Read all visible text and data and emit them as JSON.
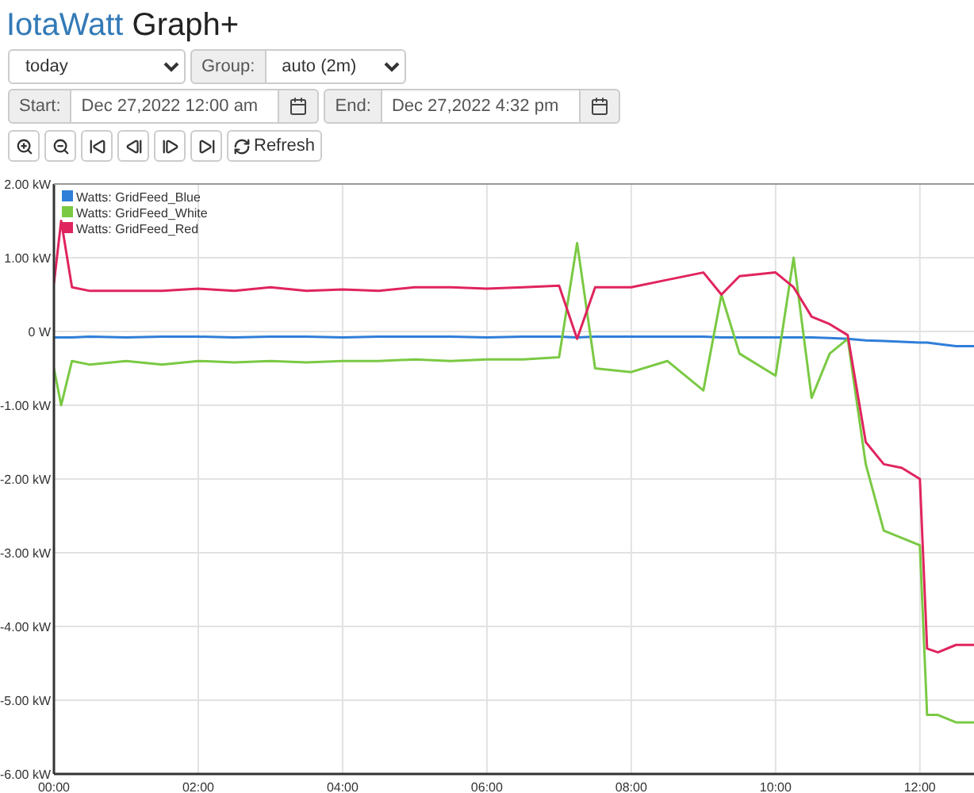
{
  "title": {
    "brand": "IotaWatt",
    "suffix": "Graph+"
  },
  "period_select": {
    "value": "today"
  },
  "group": {
    "label": "Group:",
    "value": "auto (2m)"
  },
  "start": {
    "label": "Start:",
    "value": "Dec 27,2022 12:00 am"
  },
  "end": {
    "label": "End:",
    "value": "Dec 27,2022 4:32 pm"
  },
  "toolbar": [
    {
      "kind": "zoom-in"
    },
    {
      "kind": "zoom-out"
    },
    {
      "kind": "first"
    },
    {
      "kind": "prev"
    },
    {
      "kind": "next"
    },
    {
      "kind": "last"
    },
    {
      "kind": "refresh",
      "label": "Refresh"
    }
  ],
  "chart": {
    "chart_data": {
      "type": "line",
      "grid": true,
      "legend": true,
      "x": [
        0,
        0.1,
        0.25,
        0.5,
        1,
        1.5,
        2,
        2.5,
        3,
        3.5,
        4,
        4.5,
        5,
        5.5,
        6,
        6.5,
        7,
        7.25,
        7.5,
        8,
        8.5,
        9,
        9.25,
        9.5,
        10,
        10.25,
        10.5,
        10.75,
        11,
        11.25,
        11.5,
        11.75,
        12,
        12.1,
        12.25,
        12.5,
        12.75
      ],
      "series": [
        {
          "name": "Watts: GridFeed_Blue",
          "color": "#2f7ed8",
          "values": [
            -0.08,
            -0.08,
            -0.08,
            -0.07,
            -0.08,
            -0.07,
            -0.07,
            -0.08,
            -0.07,
            -0.07,
            -0.08,
            -0.07,
            -0.07,
            -0.07,
            -0.08,
            -0.07,
            -0.07,
            -0.08,
            -0.07,
            -0.07,
            -0.07,
            -0.07,
            -0.08,
            -0.08,
            -0.08,
            -0.08,
            -0.08,
            -0.09,
            -0.1,
            -0.12,
            -0.13,
            -0.14,
            -0.15,
            -0.15,
            -0.17,
            -0.2,
            -0.2
          ]
        },
        {
          "name": "Watts: GridFeed_White",
          "color": "#7ac943",
          "values": [
            -0.5,
            -1.0,
            -0.4,
            -0.45,
            -0.4,
            -0.45,
            -0.4,
            -0.42,
            -0.4,
            -0.42,
            -0.4,
            -0.4,
            -0.38,
            -0.4,
            -0.38,
            -0.38,
            -0.35,
            1.2,
            -0.5,
            -0.55,
            -0.4,
            -0.8,
            0.5,
            -0.3,
            -0.6,
            1.0,
            -0.9,
            -0.3,
            -0.1,
            -1.8,
            -2.7,
            -2.8,
            -2.9,
            -5.2,
            -5.2,
            -5.3,
            -5.3
          ]
        },
        {
          "name": "Watts: GridFeed_Red",
          "color": "#e0245e",
          "values": [
            0.65,
            1.5,
            0.6,
            0.55,
            0.55,
            0.55,
            0.58,
            0.55,
            0.6,
            0.55,
            0.57,
            0.55,
            0.6,
            0.6,
            0.58,
            0.6,
            0.62,
            -0.1,
            0.6,
            0.6,
            0.7,
            0.8,
            0.5,
            0.75,
            0.8,
            0.6,
            0.2,
            0.1,
            -0.05,
            -1.5,
            -1.8,
            -1.85,
            -2.0,
            -4.3,
            -4.35,
            -4.25,
            -4.25
          ]
        }
      ],
      "xlim": [
        0,
        12.75
      ],
      "ylim": [
        -6,
        2
      ],
      "xticks": [
        {
          "value": 0,
          "label": "00:00"
        },
        {
          "value": 2,
          "label": "02:00"
        },
        {
          "value": 4,
          "label": "04:00"
        },
        {
          "value": 6,
          "label": "06:00"
        },
        {
          "value": 8,
          "label": "08:00"
        },
        {
          "value": 10,
          "label": "10:00"
        },
        {
          "value": 12,
          "label": "12:00"
        }
      ],
      "yticks": [
        {
          "value": 2,
          "label": "2.00 kW"
        },
        {
          "value": 1,
          "label": "1.00 kW"
        },
        {
          "value": 0,
          "label": "0 W"
        },
        {
          "value": -1,
          "label": "-1.00 kW"
        },
        {
          "value": -2,
          "label": "-2.00 kW"
        },
        {
          "value": -3,
          "label": "-3.00 kW"
        },
        {
          "value": -4,
          "label": "-4.00 kW"
        },
        {
          "value": -5,
          "label": "-5.00 kW"
        },
        {
          "value": -6,
          "label": "-6.00 kW"
        }
      ]
    }
  }
}
